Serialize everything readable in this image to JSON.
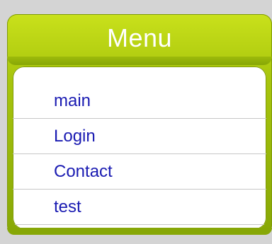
{
  "menu": {
    "title": "Menu",
    "items": [
      {
        "label": "main"
      },
      {
        "label": "Login"
      },
      {
        "label": "Contact"
      },
      {
        "label": "test"
      }
    ]
  },
  "colors": {
    "page_background": "#d4d4d4",
    "header_green": "#a9c60d",
    "link_blue": "#1a1bb2",
    "panel_white": "#ffffff"
  }
}
